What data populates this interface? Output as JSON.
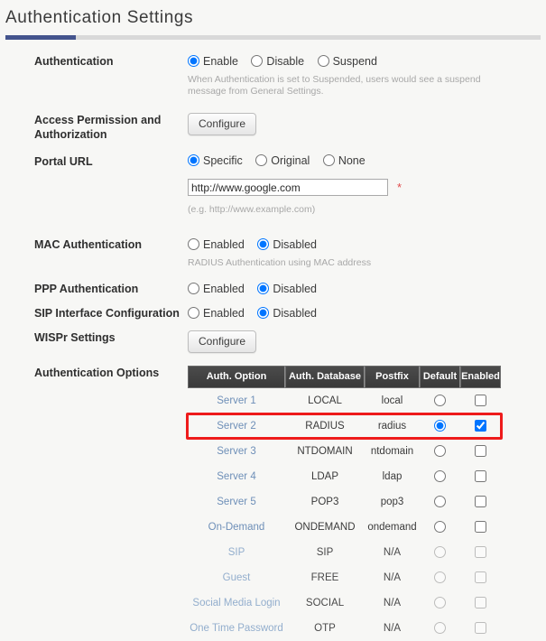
{
  "page": {
    "title": "Authentication Settings",
    "accent_color": "#44548d",
    "highlight_color": "#ee1b1b",
    "link_color": "#6e8fb8",
    "required_marker": "*"
  },
  "form": {
    "authentication": {
      "label": "Authentication",
      "options": [
        "Enable",
        "Disable",
        "Suspend"
      ],
      "selected": "Enable",
      "hint": "When Authentication is set to Suspended, users would see a suspend message from General Settings."
    },
    "access_permission": {
      "label": "Access Permission and Authorization",
      "label_line1": "Access Permission and",
      "label_line2": "Authorization",
      "button": "Configure"
    },
    "portal_url": {
      "label": "Portal URL",
      "options": [
        "Specific",
        "Original",
        "None"
      ],
      "selected": "Specific",
      "value": "http://www.google.com",
      "placeholder": "http://www.example.com",
      "hint": "(e.g. http://www.example.com)"
    },
    "mac_authentication": {
      "label": "MAC Authentication",
      "options": [
        "Enabled",
        "Disabled"
      ],
      "selected": "Disabled",
      "hint": "RADIUS Authentication using MAC address"
    },
    "ppp_authentication": {
      "label": "PPP Authentication",
      "options": [
        "Enabled",
        "Disabled"
      ],
      "selected": "Disabled"
    },
    "sip_interface": {
      "label": "SIP Interface Configuration",
      "options": [
        "Enabled",
        "Disabled"
      ],
      "selected": "Disabled"
    },
    "wispr_settings": {
      "label": "WISPr Settings",
      "button": "Configure"
    },
    "authentication_options": {
      "label": "Authentication Options"
    }
  },
  "table": {
    "columns": [
      "Auth. Option",
      "Auth. Database",
      "Postfix",
      "Default",
      "Enabled"
    ],
    "rows": [
      {
        "option": "Server 1",
        "database": "LOCAL",
        "postfix": "local",
        "default": false,
        "enabled": false,
        "dim": false
      },
      {
        "option": "Server 2",
        "database": "RADIUS",
        "postfix": "radius",
        "default": true,
        "enabled": true,
        "dim": false
      },
      {
        "option": "Server 3",
        "database": "NTDOMAIN",
        "postfix": "ntdomain",
        "default": false,
        "enabled": false,
        "dim": false
      },
      {
        "option": "Server 4",
        "database": "LDAP",
        "postfix": "ldap",
        "default": false,
        "enabled": false,
        "dim": false
      },
      {
        "option": "Server 5",
        "database": "POP3",
        "postfix": "pop3",
        "default": false,
        "enabled": false,
        "dim": false
      },
      {
        "option": "On-Demand",
        "database": "ONDEMAND",
        "postfix": "ondemand",
        "default": false,
        "enabled": false,
        "dim": false
      },
      {
        "option": "SIP",
        "database": "SIP",
        "postfix": "N/A",
        "default": false,
        "enabled": false,
        "dim": true
      },
      {
        "option": "Guest",
        "database": "FREE",
        "postfix": "N/A",
        "default": false,
        "enabled": false,
        "dim": true
      },
      {
        "option": "Social Media Login",
        "database": "SOCIAL",
        "postfix": "N/A",
        "default": false,
        "enabled": false,
        "dim": true
      },
      {
        "option": "One Time Password",
        "database": "OTP",
        "postfix": "N/A",
        "default": false,
        "enabled": false,
        "dim": true
      }
    ],
    "highlighted_row_index": 1
  }
}
